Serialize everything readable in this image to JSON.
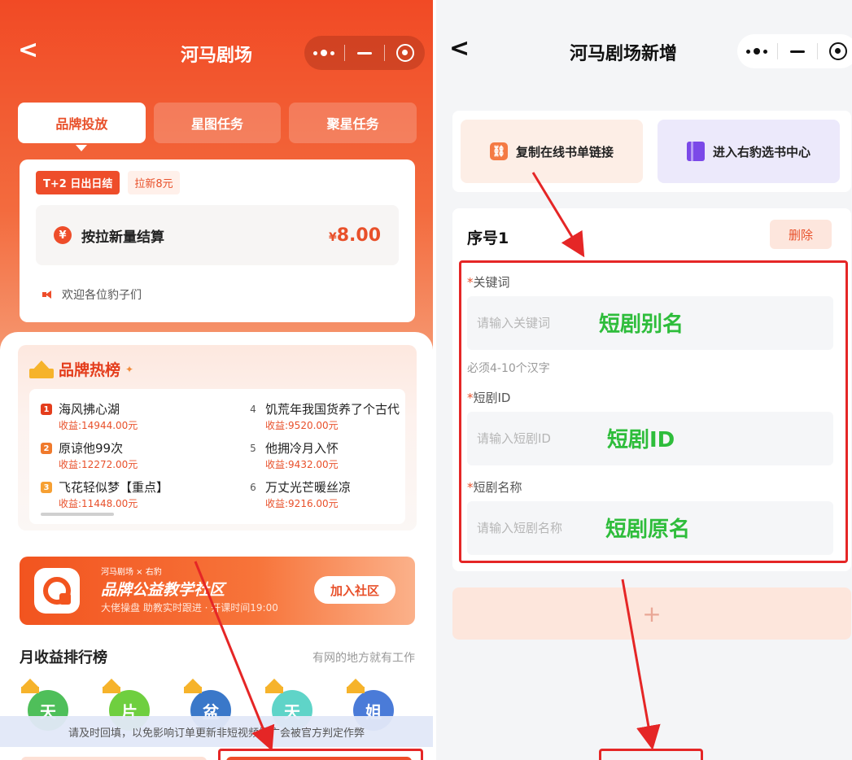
{
  "left": {
    "title": "河马剧场",
    "tabs": [
      "品牌投放",
      "星图任务",
      "聚星任务"
    ],
    "settle": {
      "badge": "T+2 日出日结",
      "sub_badge": "拉新8元",
      "label": "按拉新量结算",
      "coin_icon": "¥",
      "price_symbol": "¥",
      "price": "8.00",
      "notice": "欢迎各位豹子们"
    },
    "hot": {
      "title": "品牌热榜",
      "items": [
        {
          "rank": "1",
          "name": "海风拂心湖",
          "income": "收益:14944.00元"
        },
        {
          "rank": "2",
          "name": "原谅他99次",
          "income": "收益:12272.00元"
        },
        {
          "rank": "3",
          "name": "飞花轻似梦【重点】",
          "income": "收益:11448.00元"
        },
        {
          "rank": "4",
          "name": "饥荒年我国货养了个古代",
          "income": "收益:9520.00元"
        },
        {
          "rank": "5",
          "name": "他拥冷月入怀",
          "income": "收益:9432.00元"
        },
        {
          "rank": "6",
          "name": "万丈光芒暖丝凉",
          "income": "收益:9216.00元"
        }
      ]
    },
    "community": {
      "tag": "河马剧场 × 右豹",
      "title": "品牌公益教学社区",
      "sub": "大佬操盘 助教实时跟进 · 开课时间19:00",
      "button": "加入社区"
    },
    "month": {
      "title": "月收益排行榜",
      "link": "有网的地方就有工作",
      "avatars": [
        "天",
        "片",
        "盆",
        "天",
        "姐"
      ],
      "avatar_colors": [
        "#4fbf5a",
        "#6fcf3f",
        "#3a78c9",
        "#5fd4c8",
        "#4a7bd8"
      ]
    },
    "bottom_notice": "请及时回填，以免影响订单更新非短视频推广会被官方判定作弊"
  },
  "right": {
    "title": "河马剧场新增",
    "actions": {
      "copy_link": "复制在线书单链接",
      "book_center": "进入右豹选书中心"
    },
    "form": {
      "seq_title": "序号1",
      "delete": "删除",
      "fields": [
        {
          "label": "关键词",
          "placeholder": "请输入关键词",
          "annotation": "短剧别名"
        },
        {
          "label": "短剧ID",
          "placeholder": "请输入短剧ID",
          "annotation": "短剧ID"
        },
        {
          "label": "短剧名称",
          "placeholder": "请输入短剧名称",
          "annotation": "短剧原名"
        }
      ],
      "hint": "必须4-10个汉字",
      "add": "+"
    }
  },
  "colors": {
    "brand_orange": "#ee4d2a",
    "annotation_green": "#2ebd3b",
    "annotation_red": "#e52626"
  }
}
